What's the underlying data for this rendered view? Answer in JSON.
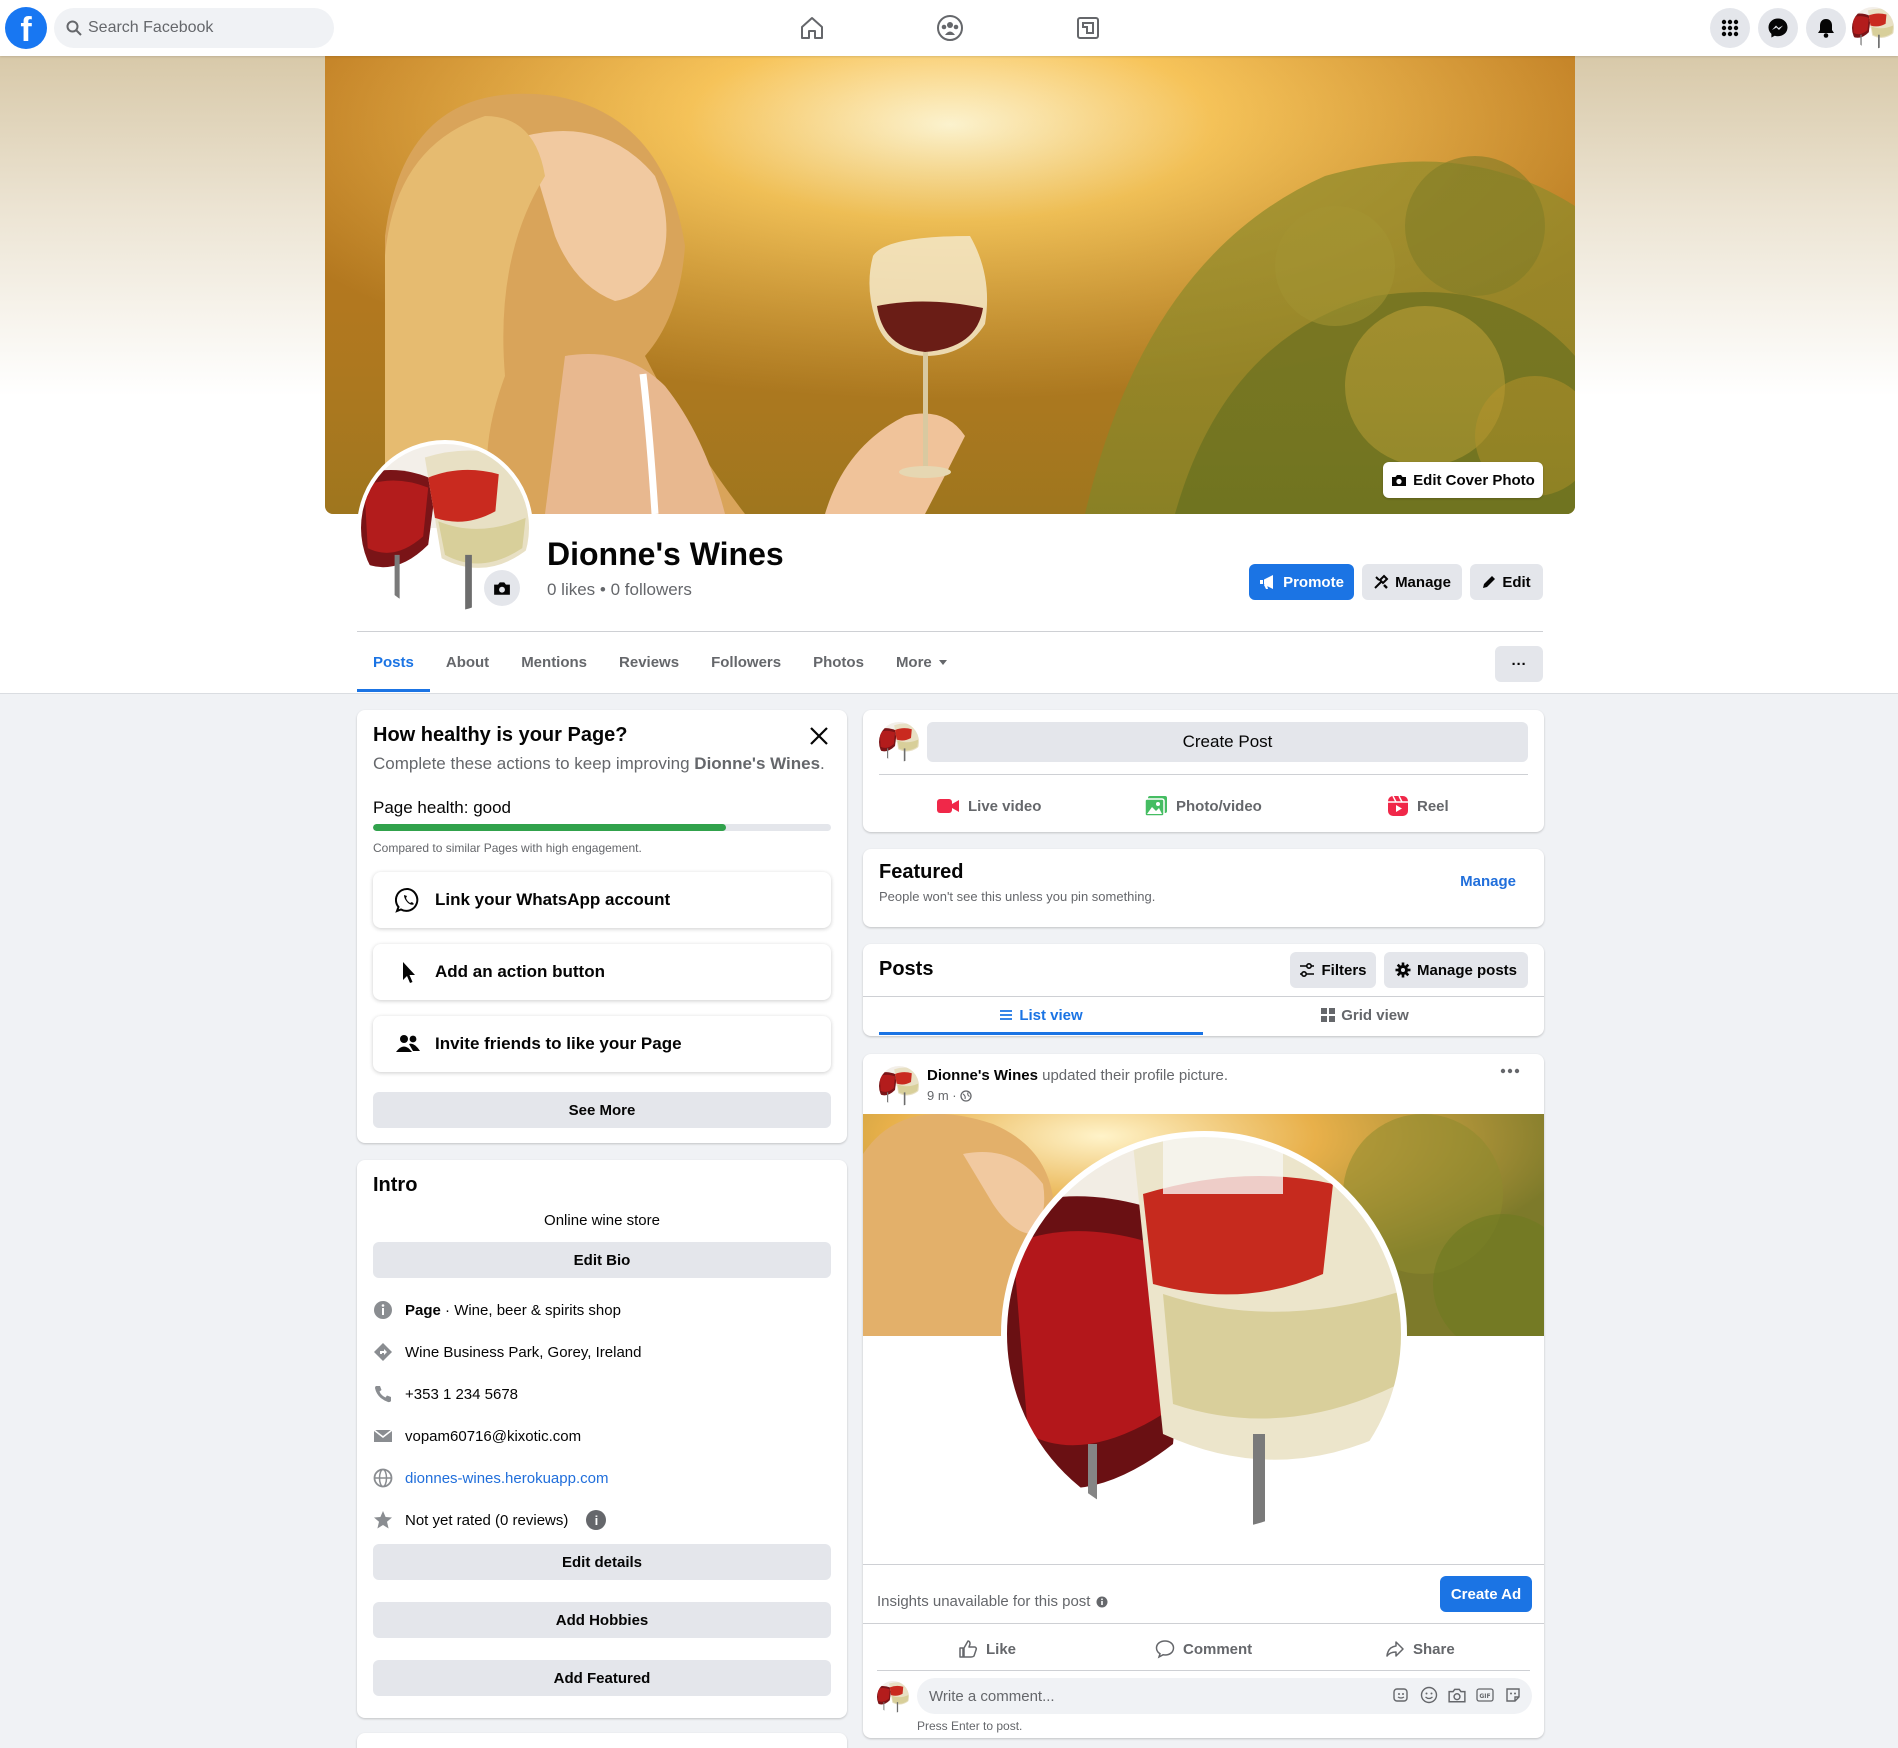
{
  "topbar": {
    "logo": "f",
    "search_placeholder": "Search Facebook",
    "nav_icons": [
      "home-icon",
      "groups-icon",
      "gaming-icon"
    ],
    "right_icons": [
      "menu-grid-icon",
      "messenger-icon",
      "notifications-icon"
    ]
  },
  "header": {
    "edit_cover_label": "Edit Cover Photo",
    "page_name": "Dionne's Wines",
    "stats": "0 likes • 0 followers",
    "promote_label": "Promote",
    "manage_label": "Manage",
    "edit_label": "Edit",
    "more_dots": "···"
  },
  "tabs": [
    {
      "label": "Posts",
      "active": true
    },
    {
      "label": "About"
    },
    {
      "label": "Mentions"
    },
    {
      "label": "Reviews"
    },
    {
      "label": "Followers"
    },
    {
      "label": "Photos"
    },
    {
      "label": "More"
    }
  ],
  "health": {
    "title": "How healthy is your Page?",
    "subtitle_prefix": "Complete these actions to keep improving ",
    "subtitle_page": "Dionne's Wines",
    "subtitle_suffix": ".",
    "label": "Page health: good",
    "progress_fraction": 0.77,
    "compare": "Compared to similar Pages with high engagement.",
    "actions": [
      {
        "label": "Link your WhatsApp account",
        "icon": "whatsapp-icon"
      },
      {
        "label": "Add an action button",
        "icon": "cursor-icon"
      },
      {
        "label": "Invite friends to like your Page",
        "icon": "people-icon"
      }
    ],
    "see_more": "See More"
  },
  "intro": {
    "title": "Intro",
    "bio": "Online wine store",
    "edit_bio": "Edit Bio",
    "category_bold": "Page",
    "category_rest": " · Wine, beer & spirits shop",
    "address": "Wine Business Park, Gorey, Ireland",
    "phone": "+353 1 234 5678",
    "email": "vopam60716@kixotic.com",
    "website": "dionnes-wines.herokuapp.com",
    "rating": "Not yet rated (0 reviews)",
    "edit_details": "Edit details",
    "add_hobbies": "Add Hobbies",
    "add_featured": "Add Featured"
  },
  "create_post": {
    "button": "Create Post",
    "live": "Live video",
    "photo": "Photo/video",
    "reel": "Reel"
  },
  "featured": {
    "title": "Featured",
    "subtitle": "People won't see this unless you pin something.",
    "manage": "Manage"
  },
  "posts_header": {
    "title": "Posts",
    "filters": "Filters",
    "manage_posts": "Manage posts",
    "list_view": "List view",
    "grid_view": "Grid view"
  },
  "post": {
    "author": "Dionne's Wines",
    "action": " updated their profile picture.",
    "time": "9 m ·",
    "insights": "Insights unavailable for this post",
    "create_ad": "Create Ad",
    "like": "Like",
    "comment": "Comment",
    "share": "Share",
    "comment_placeholder": "Write a comment...",
    "press_enter": "Press Enter to post."
  },
  "colors": {
    "brand_blue": "#1b74e4",
    "health_green": "#31a24c",
    "background": "#f0f2f5"
  }
}
